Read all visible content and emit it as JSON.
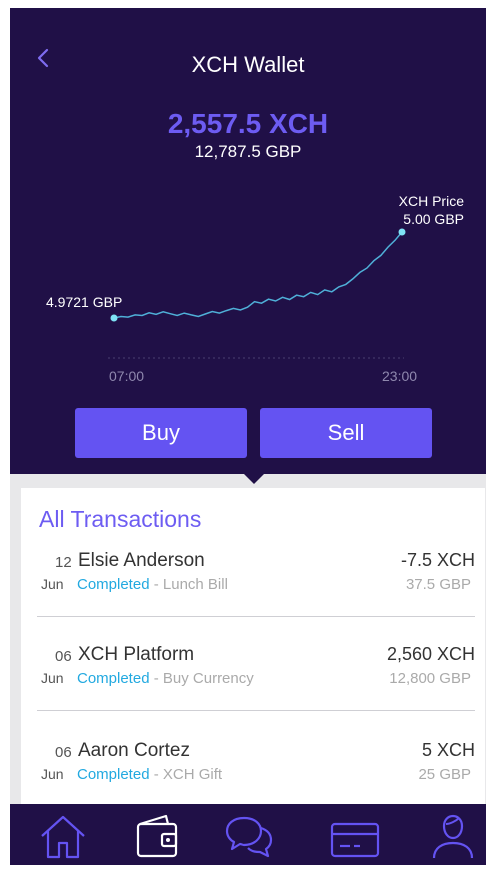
{
  "header": {
    "title": "XCH Wallet",
    "balance": "2,557.5 XCH",
    "balance_gbp": "12,787.5 GBP"
  },
  "chart_data": {
    "type": "line",
    "series": [
      {
        "values": [
          4.9721,
          4.9726,
          4.9724,
          4.9731,
          4.9729,
          4.9738,
          4.9733,
          4.9741,
          4.9735,
          4.9729,
          4.9737,
          4.9731,
          4.9726,
          4.9734,
          4.9742,
          4.9737,
          4.9745,
          4.9752,
          4.9747,
          4.9756,
          4.9774,
          4.9769,
          4.9782,
          4.9776,
          4.9788,
          4.9781,
          4.9795,
          4.979,
          4.9804,
          4.9797,
          4.9812,
          4.9806,
          4.9822,
          4.983,
          4.9848,
          4.9869,
          4.9883,
          4.9907,
          4.9924,
          4.9951,
          4.9973,
          5.0
        ]
      }
    ],
    "x": [
      "07:00",
      "23:00"
    ],
    "start_label": "4.9721 GBP",
    "end_label_title": "XCH Price",
    "end_label_value": "5.00 GBP",
    "grid": false,
    "colors": {
      "line": "#4fb0d8",
      "endpoint": "#7fe3f5"
    }
  },
  "actions": {
    "buy_label": "Buy",
    "sell_label": "Sell"
  },
  "transactions": {
    "title": "All Transactions",
    "items": [
      {
        "day": "12",
        "month": "Jun",
        "name": "Elsie Anderson",
        "status": "Completed",
        "description": "- Lunch Bill",
        "amount": "-7.5 XCH",
        "amount_gbp": "37.5 GBP"
      },
      {
        "day": "06",
        "month": "Jun",
        "name": "XCH Platform",
        "status": "Completed",
        "description": "- Buy Currency",
        "amount": "2,560 XCH",
        "amount_gbp": "12,800 GBP"
      },
      {
        "day": "06",
        "month": "Jun",
        "name": "Aaron Cortez",
        "status": "Completed",
        "description": "- XCH Gift",
        "amount": "5 XCH",
        "amount_gbp": "25 GBP"
      }
    ]
  },
  "nav": {
    "items": [
      "home-icon",
      "wallet-icon",
      "chat-icon",
      "card-icon",
      "profile-icon"
    ],
    "active": "wallet-icon"
  },
  "colors": {
    "header_bg": "#201047",
    "accent": "#6453f2",
    "status": "#22a9e0"
  }
}
